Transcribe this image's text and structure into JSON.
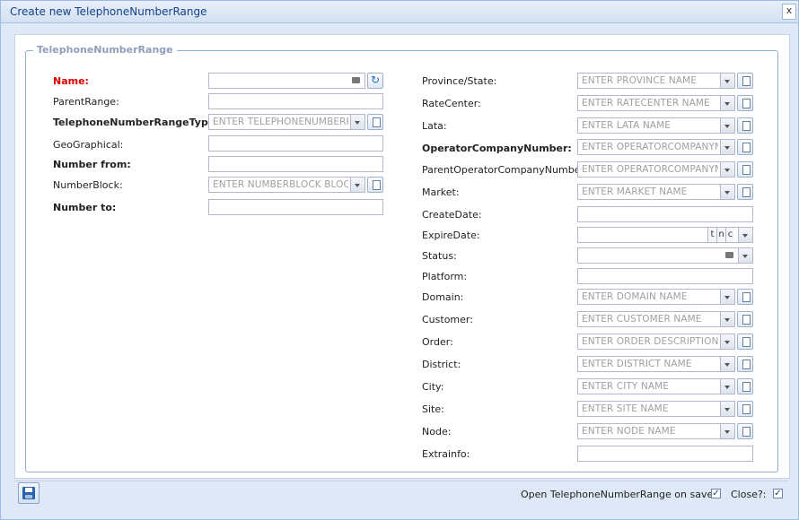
{
  "window": {
    "title": "Create new TelephoneNumberRange",
    "close_label": "x"
  },
  "fieldset": {
    "legend": "TelephoneNumberRange"
  },
  "left": {
    "name_label": "Name:",
    "parentrange_label": "ParentRange:",
    "type_label": "TelephoneNumberRangeType:",
    "type_placeholder": "ENTER TELEPHONENUMBERRAI",
    "geographical_label": "GeoGraphical:",
    "numberfrom_label": "Number from:",
    "numberblock_label": "NumberBlock:",
    "numberblock_placeholder": "ENTER NUMBERBLOCK BLOCK",
    "numberto_label": "Number to:"
  },
  "right": {
    "province_label": "Province/State:",
    "province_placeholder": "ENTER PROVINCE NAME",
    "ratecenter_label": "RateCenter:",
    "ratecenter_placeholder": "ENTER RATECENTER NAME",
    "lata_label": "Lata:",
    "lata_placeholder": "ENTER LATA NAME",
    "opcompany_label": "OperatorCompanyNumber:",
    "opcompany_placeholder": "ENTER OPERATORCOMPANYNU",
    "parentop_label": "ParentOperatorCompanyNumber:",
    "parentop_placeholder": "ENTER OPERATORCOMPANYNU",
    "market_label": "Market:",
    "market_placeholder": "ENTER MARKET NAME",
    "createdate_label": "CreateDate:",
    "expiredate_label": "ExpireDate:",
    "expire_t": "t",
    "expire_n": "n",
    "expire_c": "c",
    "status_label": "Status:",
    "platform_label": "Platform:",
    "domain_label": "Domain:",
    "domain_placeholder": "ENTER DOMAIN NAME",
    "customer_label": "Customer:",
    "customer_placeholder": "ENTER CUSTOMER NAME",
    "order_label": "Order:",
    "order_placeholder": "ENTER ORDER DESCRIPTION",
    "district_label": "District:",
    "district_placeholder": "ENTER DISTRICT NAME",
    "city_label": "City:",
    "city_placeholder": "ENTER CITY NAME",
    "site_label": "Site:",
    "site_placeholder": "ENTER SITE NAME",
    "node_label": "Node:",
    "node_placeholder": "ENTER NODE NAME",
    "extrainfo_label": "Extrainfo:"
  },
  "footer": {
    "open_on_save_label": "Open TelephoneNumberRange on save?:",
    "open_on_save_checked": true,
    "close_label": "Close?:",
    "close_checked": true,
    "check_glyph": "✓"
  },
  "icons": {
    "refresh_glyph": "↻"
  }
}
